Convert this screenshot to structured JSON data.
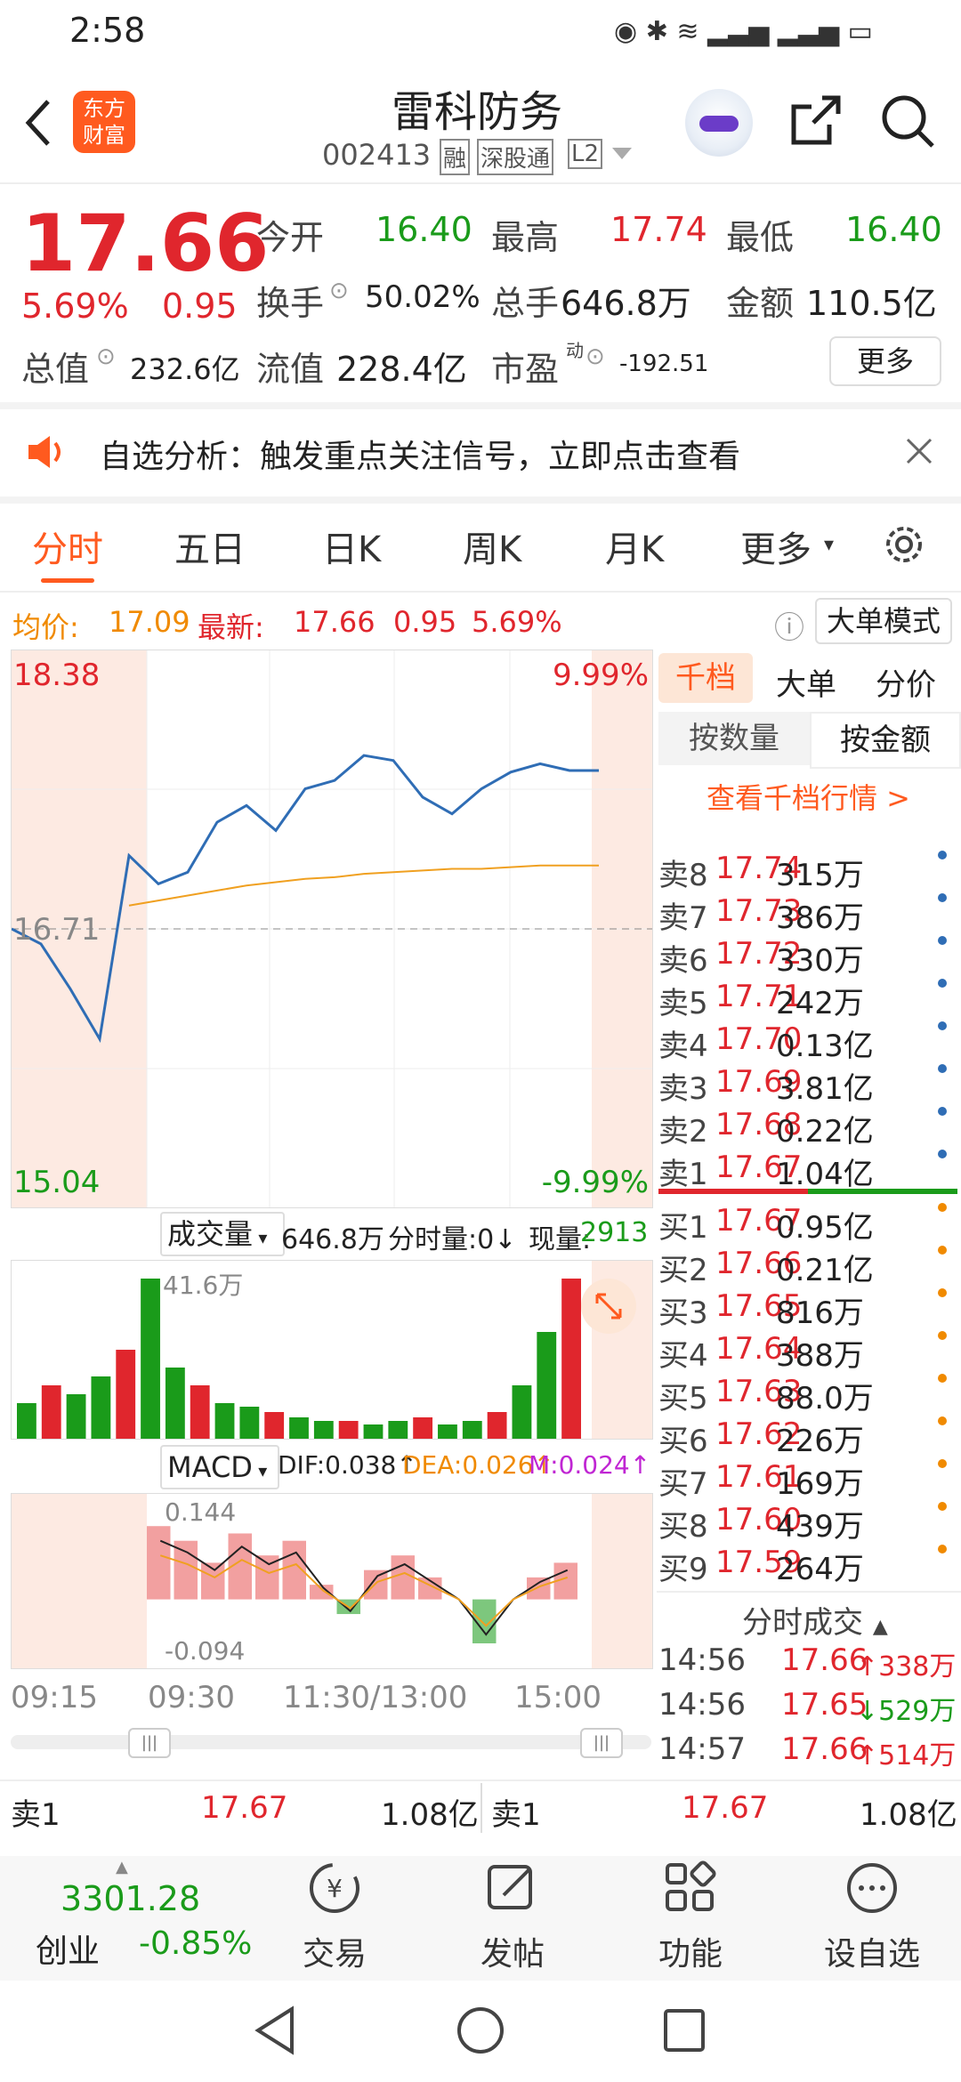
{
  "status_bar": {
    "time": "2:58"
  },
  "header": {
    "title": "雷科防务",
    "code": "002413",
    "tags": [
      "融",
      "深股通",
      "L2"
    ],
    "logo_text_1": "东方",
    "logo_text_2": "财富"
  },
  "quote": {
    "price": "17.66",
    "change_pct": "5.69%",
    "change": "0.95",
    "open_label": "今开",
    "open": "16.40",
    "high_label": "最高",
    "high": "17.74",
    "low_label": "最低",
    "low": "16.40",
    "turnover_label": "换手",
    "turnover": "50.02%",
    "volume_label": "总手",
    "volume": "646.8万",
    "amount_label": "金额",
    "amount": "110.5亿",
    "mktcap_label": "总值",
    "mktcap": "232.6亿",
    "float_label": "流值",
    "float": "228.4亿",
    "pe_label": "市盈",
    "pe_sup": "动",
    "pe": "-192.51",
    "more_button": "更多"
  },
  "notice": {
    "text": "自选分析：触发重点关注信号，立即点击查看"
  },
  "tabs": [
    "分时",
    "五日",
    "日K",
    "周K",
    "月K",
    "更多"
  ],
  "info_bar": {
    "avg_label": "均价:",
    "avg": "17.09",
    "latest_label": "最新:",
    "latest": "17.66",
    "chg": "0.95",
    "pct": "5.69%",
    "mode_button": "大单模式"
  },
  "chart_data": [
    {
      "type": "line",
      "title": "",
      "y_top_label": "18.38",
      "y_bottom_label": "15.04",
      "pct_top_label": "9.99%",
      "pct_bottom_label": "-9.99%",
      "ref_label": "16.71",
      "ylim": [
        15.04,
        18.38
      ],
      "series": [
        {
          "name": "price",
          "color": "#2f6db5",
          "x": [
            0,
            5,
            10,
            15,
            20,
            25,
            30,
            35,
            40,
            45,
            50,
            55,
            60,
            65,
            70,
            75,
            80,
            85,
            90,
            95,
            100
          ],
          "values": [
            16.71,
            16.62,
            16.35,
            16.05,
            17.15,
            16.98,
            17.05,
            17.35,
            17.45,
            17.3,
            17.55,
            17.6,
            17.75,
            17.72,
            17.5,
            17.4,
            17.55,
            17.65,
            17.7,
            17.66,
            17.66
          ]
        },
        {
          "name": "avg",
          "color": "#f0a020",
          "x": [
            0,
            5,
            10,
            15,
            20,
            25,
            30,
            35,
            40,
            45,
            50,
            55,
            60,
            65,
            70,
            75,
            80,
            85,
            90,
            95,
            100
          ],
          "values": [
            null,
            null,
            null,
            null,
            16.85,
            16.88,
            16.91,
            16.94,
            16.97,
            16.99,
            17.01,
            17.02,
            17.04,
            17.05,
            17.06,
            17.07,
            17.07,
            17.08,
            17.09,
            17.09,
            17.09
          ]
        }
      ]
    },
    {
      "type": "bar",
      "title": "成交量",
      "max_label": "41.6万",
      "values": [
        0.2,
        0.3,
        0.25,
        0.35,
        0.5,
        0.9,
        0.4,
        0.3,
        0.2,
        0.18,
        0.15,
        0.12,
        0.1,
        0.1,
        0.08,
        0.1,
        0.12,
        0.08,
        0.1,
        0.15,
        0.3,
        0.6,
        0.9
      ]
    },
    {
      "type": "line",
      "title": "MACD",
      "max_label": "0.144",
      "min_label": "-0.094",
      "values": [
        0.1,
        0.08,
        0.05,
        0.09,
        0.06,
        0.08,
        0.02,
        -0.02,
        0.04,
        0.06,
        0.03,
        0.0,
        -0.06,
        0.0,
        0.03,
        0.05
      ]
    }
  ],
  "volume_bar": {
    "selector": "成交量",
    "total": "646.8万",
    "tick_label": "分时量:0↓",
    "now_label": "现量:",
    "now": "2913"
  },
  "macd_bar": {
    "selector": "MACD",
    "dif": "DIF:0.038↑",
    "dea": "DEA:0.026↑",
    "m": "M:0.024↑"
  },
  "time_axis": [
    "09:15",
    "09:30",
    "11:30/13:00",
    "15:00"
  ],
  "order_book": {
    "tabs": [
      "千档",
      "大单",
      "分价"
    ],
    "subtabs": [
      "按数量",
      "按金额"
    ],
    "link": "查看千档行情 >",
    "asks": [
      {
        "label": "卖8",
        "price": "17.74",
        "amt": "315万"
      },
      {
        "label": "卖7",
        "price": "17.73",
        "amt": "386万"
      },
      {
        "label": "卖6",
        "price": "17.72",
        "amt": "330万"
      },
      {
        "label": "卖5",
        "price": "17.71",
        "amt": "242万"
      },
      {
        "label": "卖4",
        "price": "17.70",
        "amt": "0.13亿"
      },
      {
        "label": "卖3",
        "price": "17.69",
        "amt": "3.81亿"
      },
      {
        "label": "卖2",
        "price": "17.68",
        "amt": "0.22亿"
      },
      {
        "label": "卖1",
        "price": "17.67",
        "amt": "1.04亿"
      }
    ],
    "bids": [
      {
        "label": "买1",
        "price": "17.67",
        "amt": "0.95亿"
      },
      {
        "label": "买2",
        "price": "17.66",
        "amt": "0.21亿"
      },
      {
        "label": "买3",
        "price": "17.65",
        "amt": "816万"
      },
      {
        "label": "买4",
        "price": "17.64",
        "amt": "388万"
      },
      {
        "label": "买5",
        "price": "17.63",
        "amt": "88.0万"
      },
      {
        "label": "买6",
        "price": "17.62",
        "amt": "226万"
      },
      {
        "label": "买7",
        "price": "17.61",
        "amt": "169万"
      },
      {
        "label": "买8",
        "price": "17.60",
        "amt": "439万"
      },
      {
        "label": "买9",
        "price": "17.59",
        "amt": "264万"
      }
    ],
    "trades_title": "分时成交",
    "trades": [
      {
        "time": "14:56",
        "price": "17.66",
        "vol": "338万",
        "dir": "up"
      },
      {
        "time": "14:56",
        "price": "17.65",
        "vol": "529万",
        "dir": "down"
      },
      {
        "time": "14:57",
        "price": "17.66",
        "vol": "514万",
        "dir": "up"
      }
    ]
  },
  "bottom_quotes": [
    {
      "label": "卖1",
      "price": "17.67",
      "amt": "1.08亿"
    },
    {
      "label": "卖1",
      "price": "17.67",
      "amt": "1.08亿"
    }
  ],
  "bottom_nav": {
    "index_value": "3301.28",
    "index_name": "创业",
    "index_change": "-0.85%",
    "items": [
      "交易",
      "发帖",
      "功能",
      "设自选"
    ]
  },
  "colors": {
    "up": "#e0262d",
    "down": "#1a9b1a",
    "line": "#2f6db5",
    "avg": "#f0a020"
  }
}
